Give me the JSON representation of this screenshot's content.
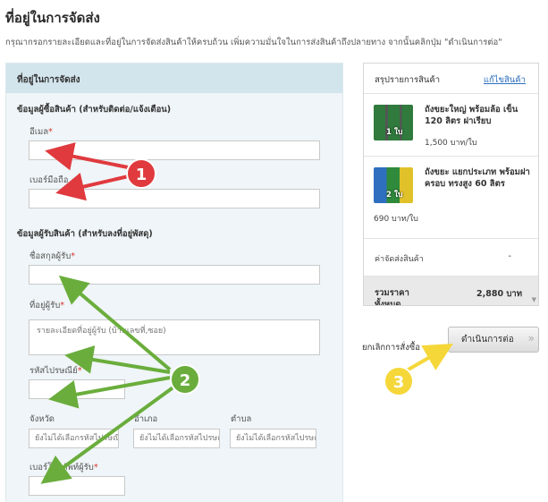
{
  "page": {
    "title": "ที่อยู่ในการจัดส่ง",
    "description": "กรุณากรอกรายละเอียดและที่อยู่ในการจัดส่งสินค้าให้ครบถ้วน เพิ่มความมั่นใจในการส่งสินค้าถึงปลายทาง จากนั้นคลิกปุ่ม \"ดำเนินการต่อ\""
  },
  "form": {
    "header": "ที่อยู่ในการจัดส่ง",
    "buyer_section": "ข้อมูลผู้ซื้อสินค้า (สำหรับติดต่อ/แจ้งเตือน)",
    "email_label": "อีเมล",
    "phone_label": "เบอร์มือถือ",
    "recipient_section": "ข้อมูลผู้รับสินค้า (สำหรับลงที่อยู่พัสดุ)",
    "name_label": "ชื่อสกุลผู้รับ",
    "address_label": "ที่อยู่ผู้รับ",
    "address_placeholder": "รายละเอียดที่อยู่ผู้รับ (บ้านเลขที่,ซอย)",
    "postcode_label": "รหัสไปรษณีย์",
    "province_label": "จังหวัด",
    "province_value": "ยังไม่ได้เลือกรหัสไปรษณีย์",
    "district_label": "อำเภอ",
    "district_value": "ยังไม่ได้เลือกรหัสไปรษณีย์",
    "subdistrict_label": "ตำบล",
    "subdistrict_value": "ยังไม่ได้เลือกรหัสไปรษณีย์",
    "recipient_phone_label": "เบอร์โทรศัพท์ผู้รับ",
    "required_mark": "*"
  },
  "summary": {
    "title": "สรุปรายการสินค้า",
    "edit_link": "แก้ไขสินค้า",
    "items": [
      {
        "name": "ถังขยะใหญ่ พร้อมล้อ เข็น 120 ลิตร ฝาเรียบ",
        "price": "1,500 บาท/ใบ",
        "qty": "1 ใบ"
      },
      {
        "name": "ถังขยะ แยกประเภท พร้อมฝาครอบ ทรงสูง 60 ลิตร",
        "price": "690 บาท/ใบ",
        "qty": "2 ใบ"
      }
    ],
    "shipping_label": "ค่าจัดส่งสินค้า",
    "shipping_value": "-",
    "total_label": "รวมราคาทั้งหมด",
    "total_value": "2,880 บาท"
  },
  "actions": {
    "cancel": "ยกเลิกการสั่งซื้อ",
    "proceed": "ดำเนินการต่อ",
    "proceed_icon": "double-chevron-right-icon"
  },
  "annotations": {
    "badge_1": "1",
    "badge_2": "2",
    "badge_3": "3"
  },
  "colors": {
    "form_header_bg": "#d2e4ec",
    "form_bg": "#eff5f8",
    "link": "#2a6ebb",
    "required": "#d9342b",
    "badge_red": "#e03a3e",
    "badge_green": "#6aad3c",
    "badge_yellow": "#f5d73a"
  }
}
